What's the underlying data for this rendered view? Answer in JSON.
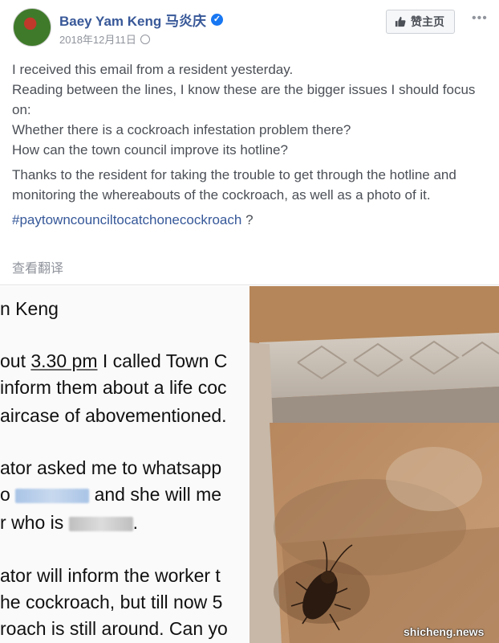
{
  "post": {
    "author": "Baey Yam Keng 马炎庆",
    "date": "2018年12月11日",
    "like_button_label": "赞主页",
    "paragraphs": [
      "I received this email from a resident yesterday.\nReading between the lines, I know these are the bigger issues I should focus on:\nWhether there is a cockroach infestation problem there?\nHow can the town council improve its hotline?",
      "Thanks to the resident for taking the trouble to get through the hotline and monitoring the whereabouts of the cockroach, as well as a photo of it."
    ],
    "hashtag": "#paytowncounciltocatchonecockroach",
    "hashtag_suffix": " ?",
    "translate_label": "查看翻译"
  },
  "email": {
    "lines": [
      "n Keng",
      "out 3.30 pm I called Town C",
      "inform them about a life coc",
      "aircase of abovementioned.",
      "ator asked me to whatsapp",
      "and she will me",
      "r who is",
      "ator will inform the worker t",
      "he cockroach, but till now 5",
      "roach is still around. Can yo"
    ],
    "time_text": "3.30 pm"
  },
  "photo": {
    "subject": "cockroach on staircase step",
    "colors": {
      "wall": "#b07e53",
      "step": "#c9c0b6",
      "insect": "#2a1a10"
    }
  },
  "watermark": "shicheng.news",
  "icons": {
    "verified": "verified-badge-icon",
    "globe": "globe-icon",
    "like": "thumbs-up-icon",
    "more": "more-options-icon"
  },
  "colors": {
    "author": "#385898",
    "text": "#4b4f56",
    "meta": "#90949c",
    "hashtag": "#365899"
  }
}
